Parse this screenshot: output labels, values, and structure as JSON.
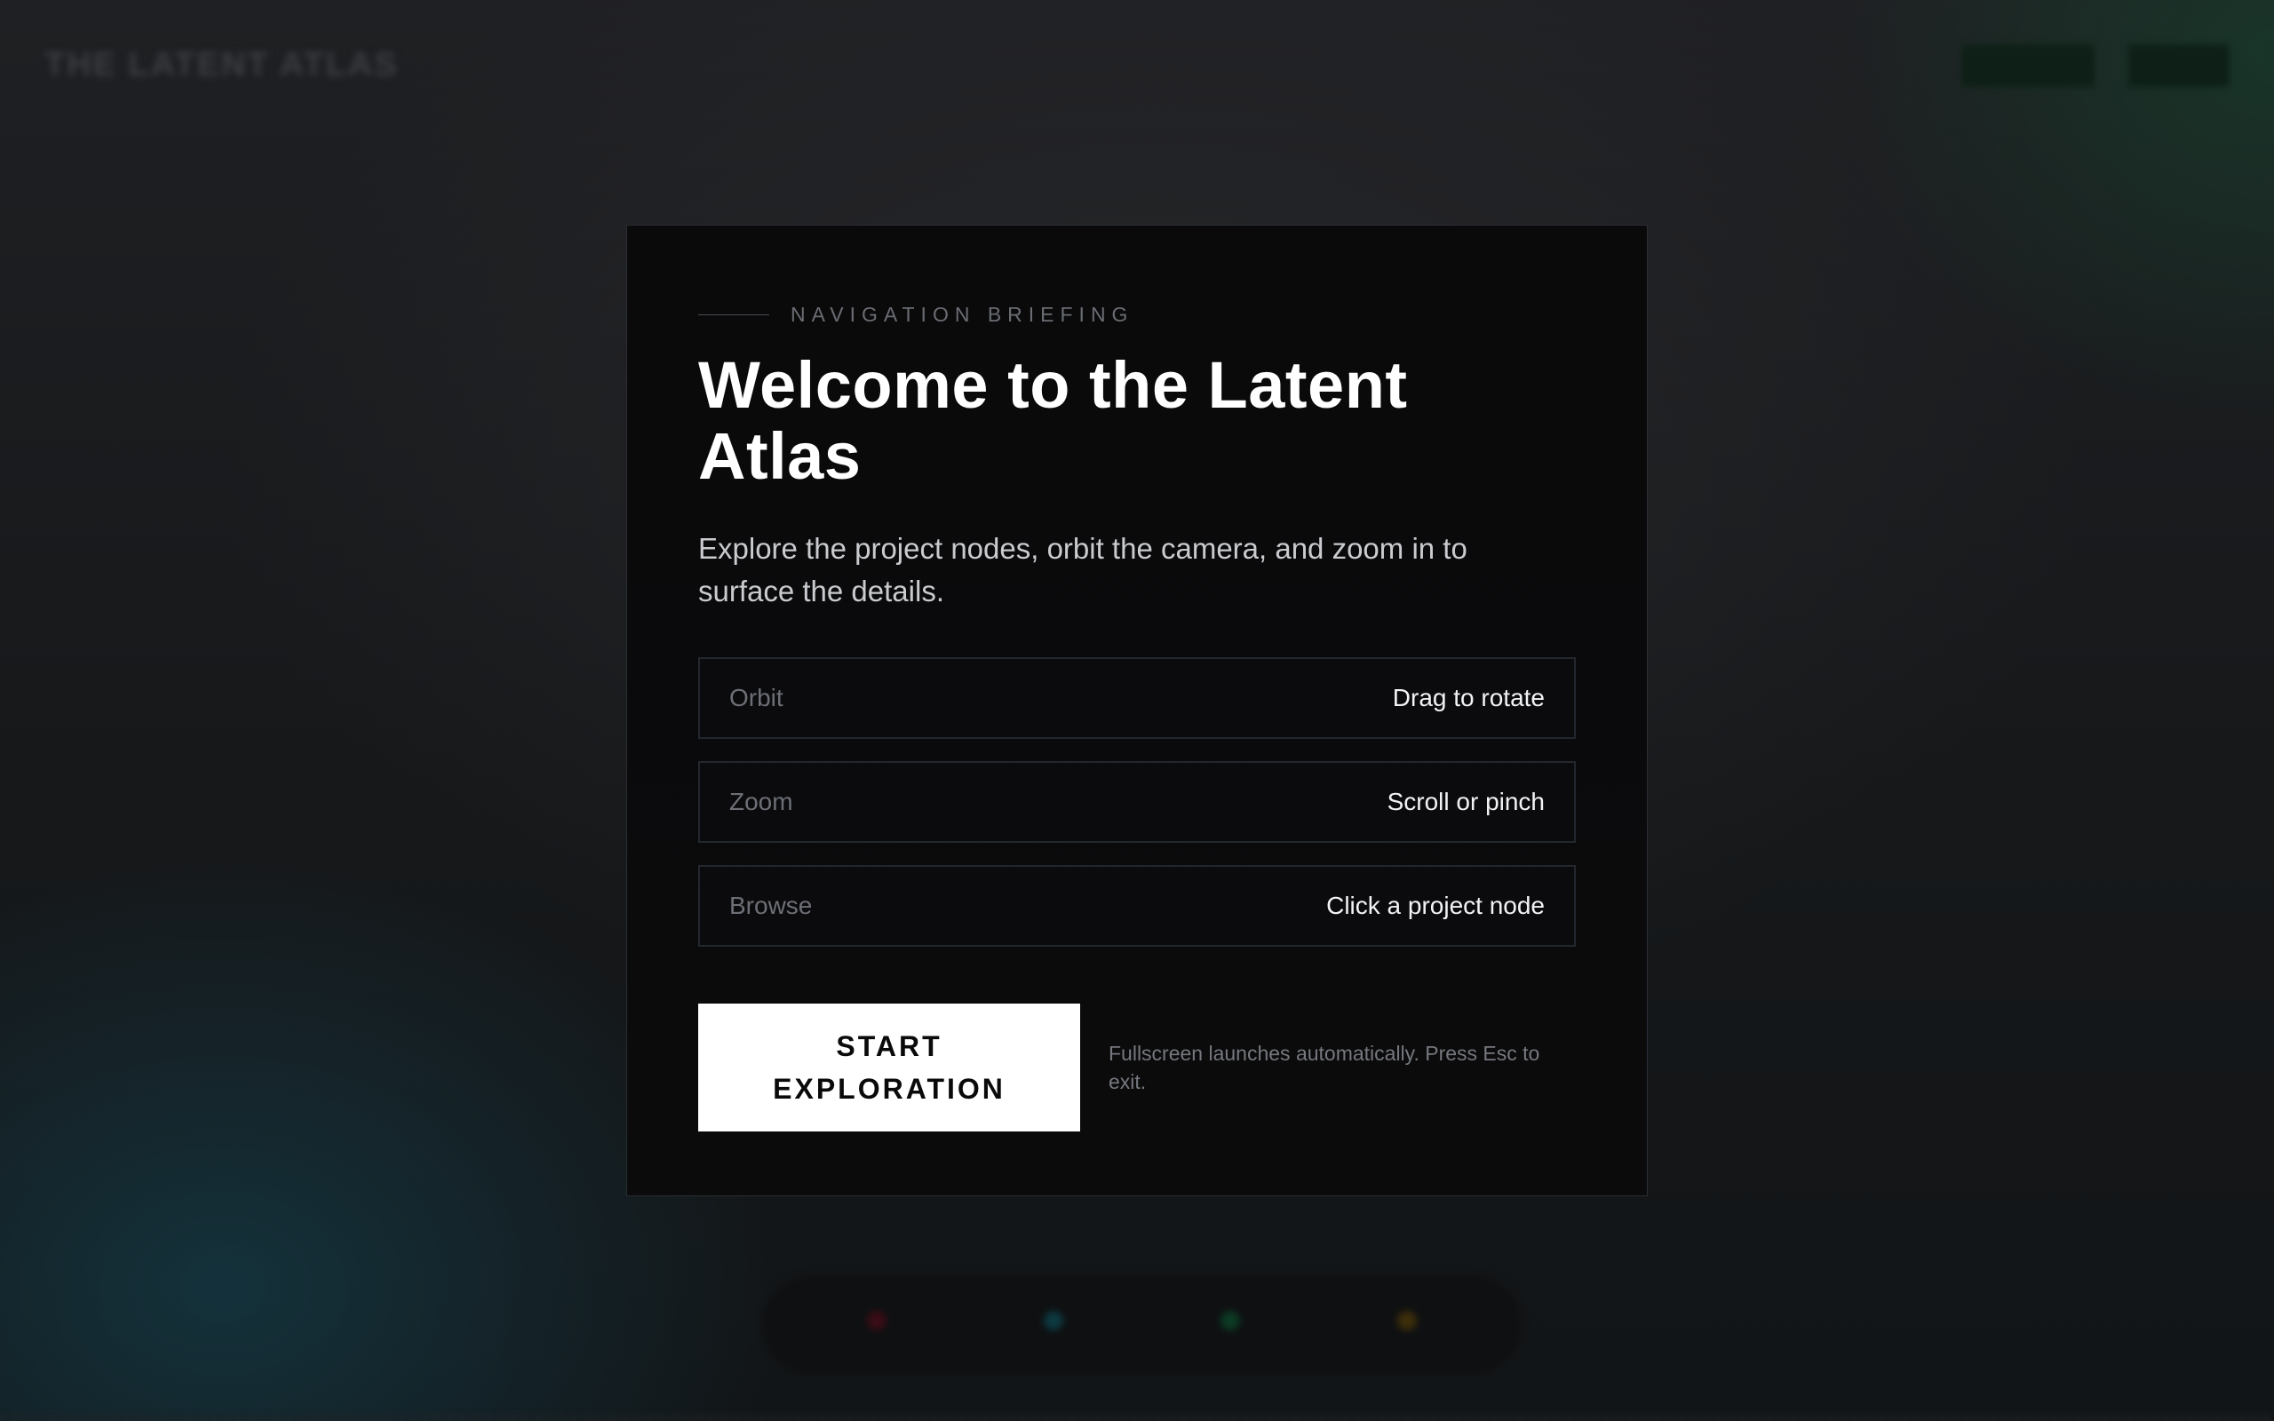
{
  "background": {
    "brand": "The Latent Atlas",
    "header_buttons": [
      "",
      ""
    ],
    "legend": [
      {
        "color": "#3a0d17"
      },
      {
        "color": "#0d3940"
      },
      {
        "color": "#0c3a24"
      },
      {
        "color": "#3d2e0b"
      }
    ]
  },
  "modal": {
    "eyebrow": "Navigation Briefing",
    "title": "Welcome to the Latent Atlas",
    "description": "Explore the project nodes, orbit the camera, and zoom in to surface the details.",
    "controls": [
      {
        "key": "Orbit",
        "value": "Drag to rotate"
      },
      {
        "key": "Zoom",
        "value": "Scroll or pinch"
      },
      {
        "key": "Browse",
        "value": "Click a project node"
      }
    ],
    "start_button": "Start Exploration",
    "note": "Fullscreen launches automatically. Press Esc to exit."
  },
  "colors": {
    "accent": "#ffffff",
    "panel": "#0a0a0b",
    "border": "#23272e"
  }
}
